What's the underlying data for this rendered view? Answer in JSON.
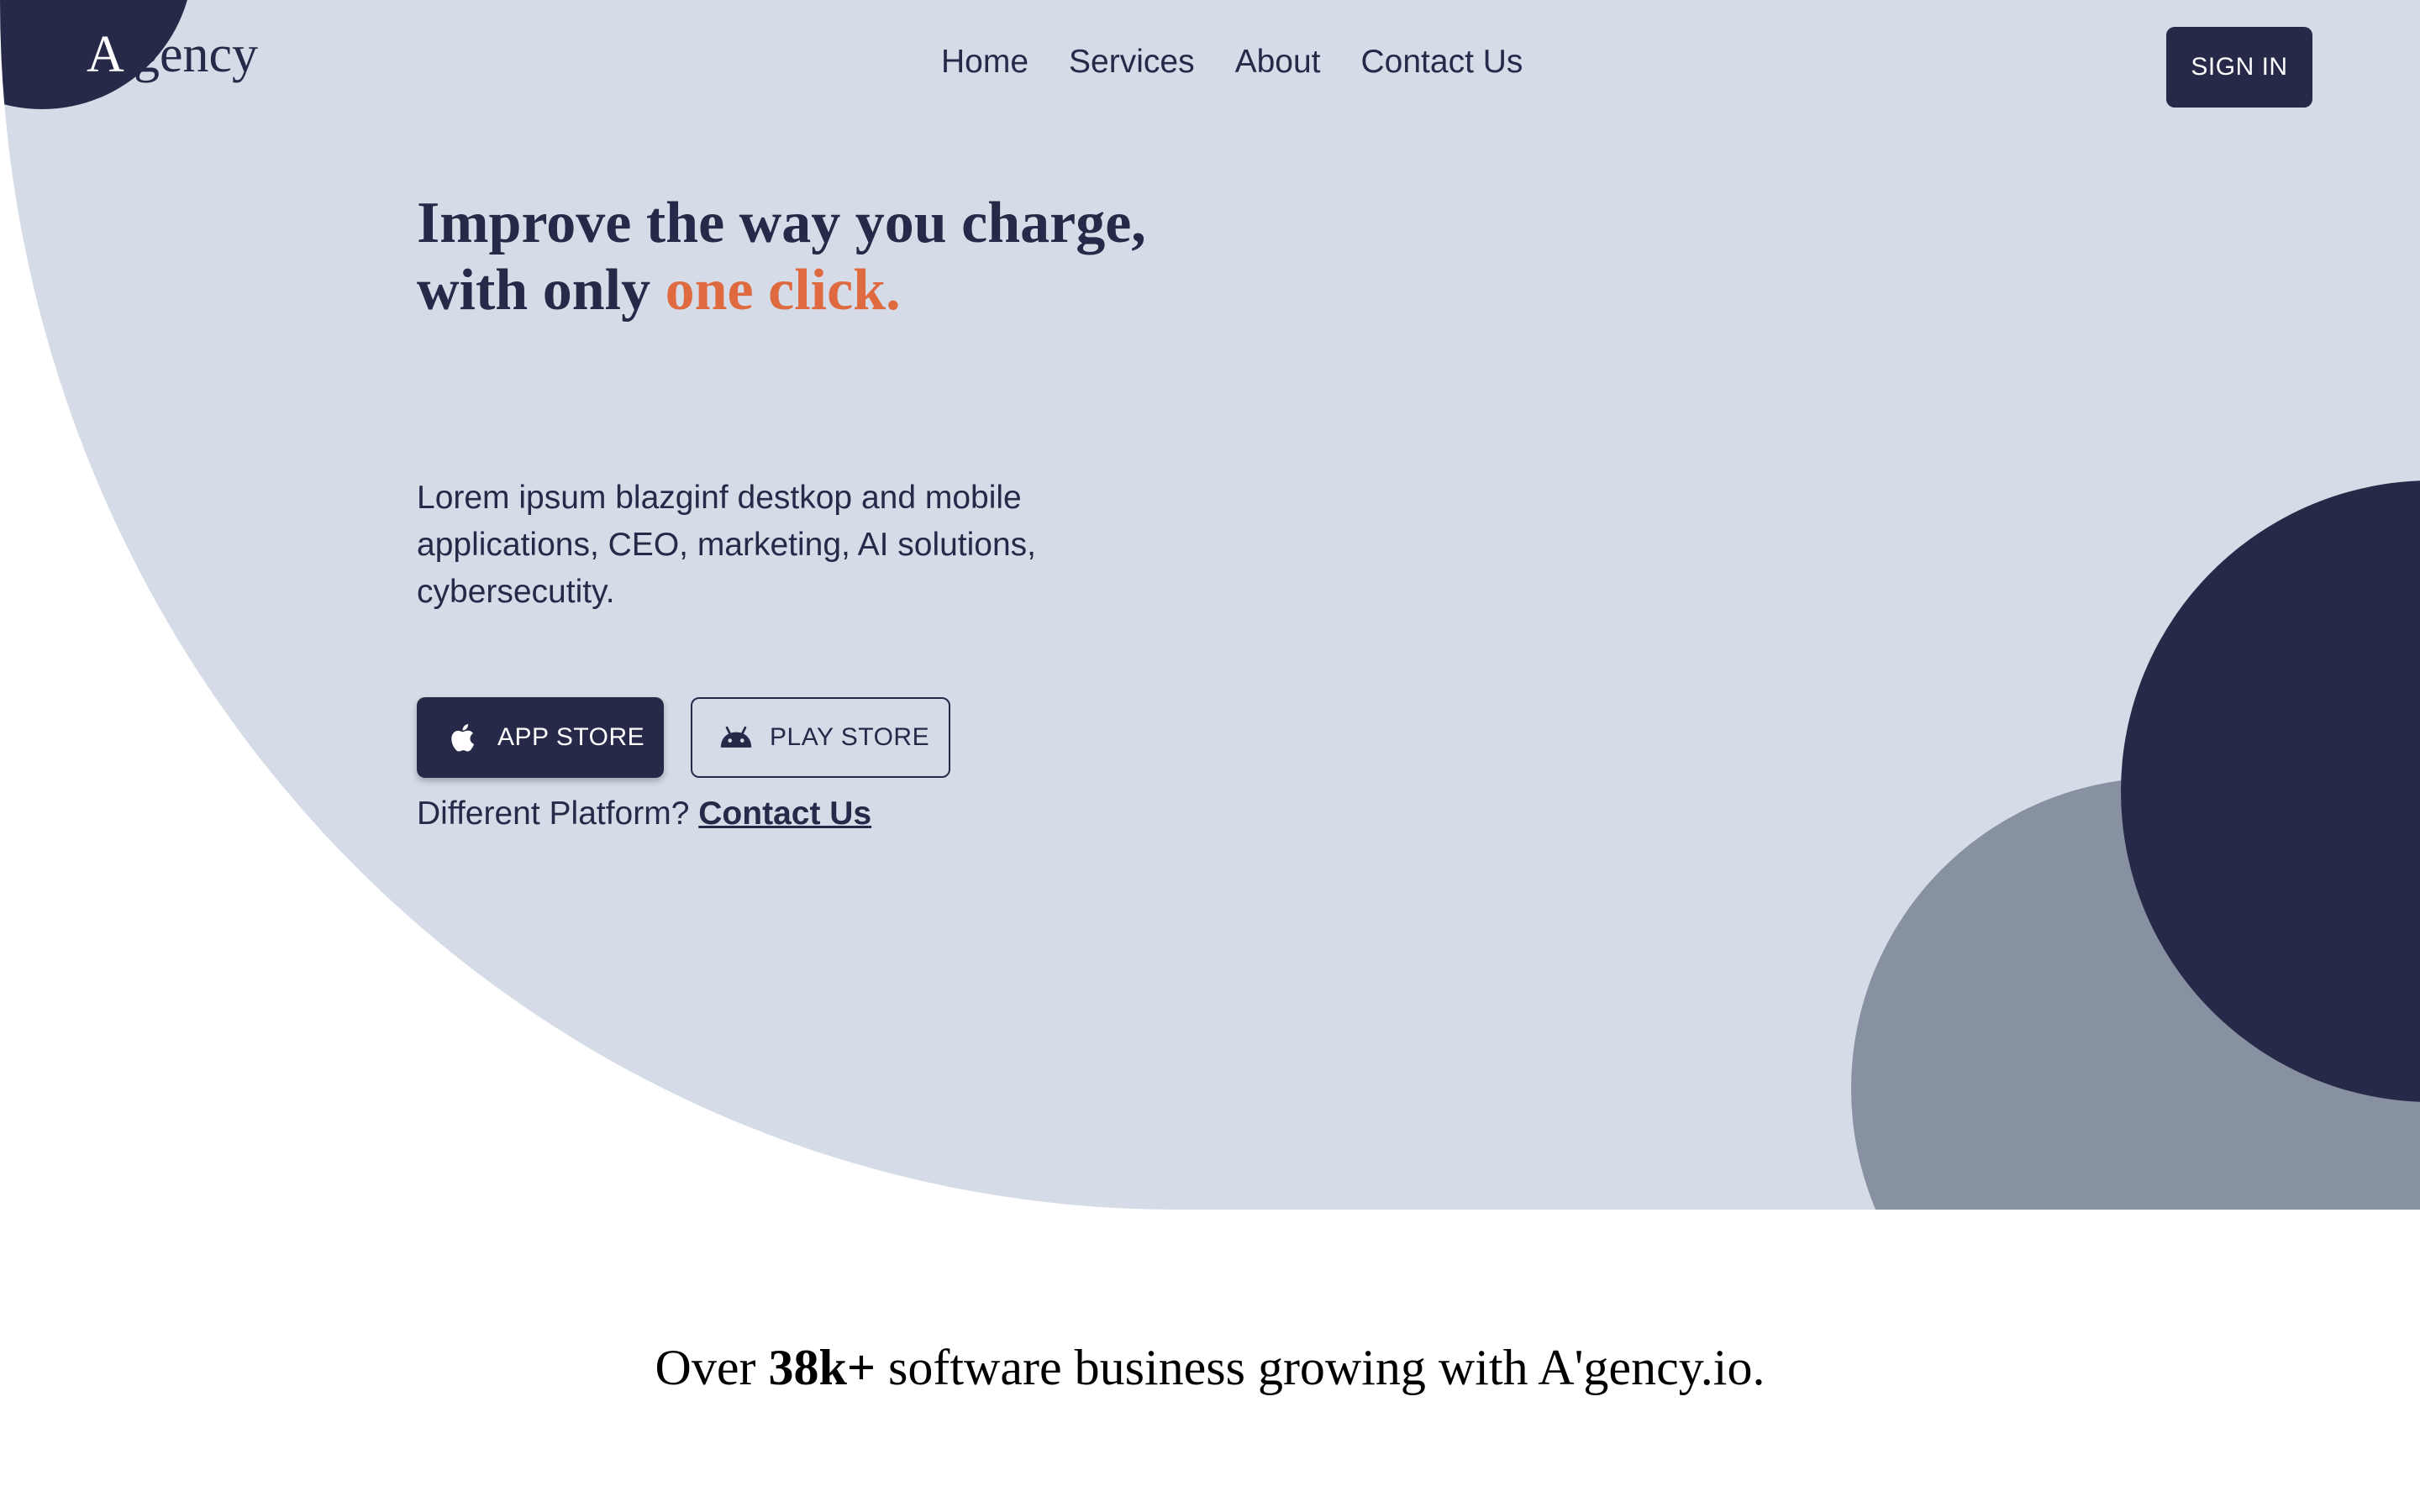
{
  "brand": {
    "logo_first": "A",
    "logo_rest": "'gency",
    "colors": {
      "navy": "#262948",
      "hero_bg": "#d5dce7",
      "accent": "#e06a3f",
      "grey_circle": "#8891a2"
    }
  },
  "nav": {
    "items": [
      {
        "label": "Home"
      },
      {
        "label": "Services"
      },
      {
        "label": "About"
      },
      {
        "label": "Contact Us"
      }
    ],
    "signin_label": "SIGN IN"
  },
  "hero": {
    "headline_main": "Improve the way you charge, with only ",
    "headline_accent": "one click.",
    "description": "Lorem ipsum blazginf destkop and mobile applications, CEO, marketing, AI solutions, cybersecutity.",
    "buttons": {
      "app_store": {
        "label": "APP STORE",
        "icon": "apple-icon"
      },
      "play_store": {
        "label": "PLAY STORE",
        "icon": "android-icon"
      }
    },
    "platform_prompt": "Different Platform?",
    "platform_link": "Contact Us"
  },
  "stats": {
    "prefix": "Over",
    "number": "38k+",
    "suffix": "software business growing with A'gency.io."
  }
}
